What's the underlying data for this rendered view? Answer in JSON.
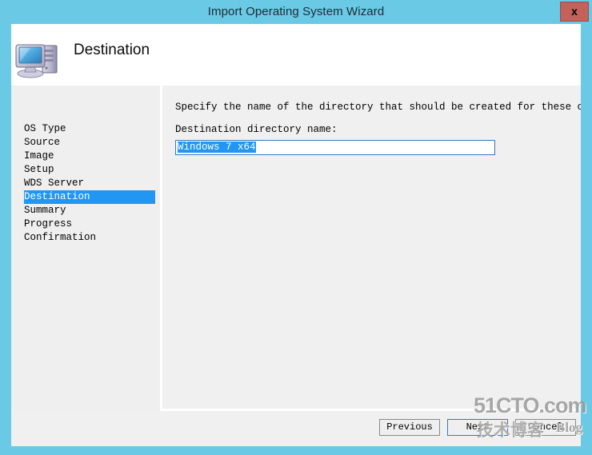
{
  "window": {
    "title": "Import Operating System Wizard",
    "close_label": "x",
    "frame_color": "#6ac9e5",
    "close_button_color": "#c4615a"
  },
  "header": {
    "title": "Destination",
    "icon": "computer-icon"
  },
  "sidebar": {
    "items": [
      {
        "label": "OS Type",
        "selected": false
      },
      {
        "label": "Source",
        "selected": false
      },
      {
        "label": "Image",
        "selected": false
      },
      {
        "label": "Setup",
        "selected": false
      },
      {
        "label": "WDS Server",
        "selected": false
      },
      {
        "label": "Destination",
        "selected": true
      },
      {
        "label": "Summary",
        "selected": false
      },
      {
        "label": "Progress",
        "selected": false
      },
      {
        "label": "Confirmation",
        "selected": false
      }
    ],
    "highlight_color": "#2196f3"
  },
  "content": {
    "instruction": "Specify the name of the directory that should be created for these operating system files.",
    "field_label": "Destination directory name:",
    "input": {
      "value": "Windows 7 x64",
      "placeholder": "",
      "selected": true
    }
  },
  "footer": {
    "buttons": [
      {
        "label": "Previous",
        "name": "previous-button",
        "focused": false
      },
      {
        "label": "Next",
        "name": "next-button",
        "focused": true
      },
      {
        "label": "Cancel",
        "name": "cancel-button",
        "focused": false
      }
    ]
  },
  "watermark": {
    "main": "51CTO.com",
    "sub_cn": "技术博客",
    "sub_en": "Blog"
  }
}
